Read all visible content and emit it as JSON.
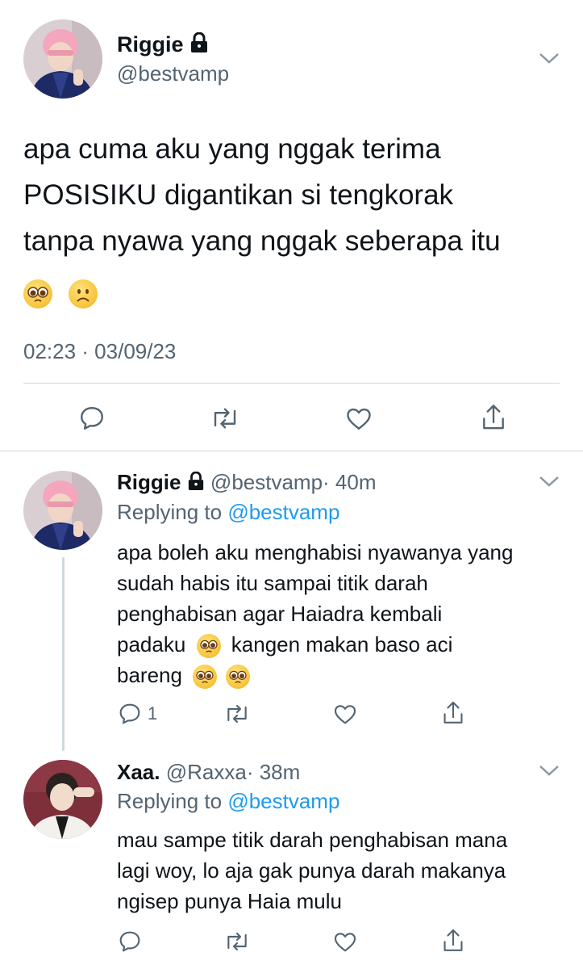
{
  "main_tweet": {
    "name": "Riggie",
    "handle": "@bestvamp",
    "text_line1": "apa cuma aku yang nggak terima",
    "text_line2": "POSISIKU digantikan si tengkorak",
    "text_line3": "tanpa nyawa yang nggak seberapa itu",
    "emojis": [
      "pleading-face",
      "frowning-face"
    ],
    "timestamp": "02:23 · 03/09/23"
  },
  "reply1": {
    "name": "Riggie",
    "handle": "@bestvamp",
    "time": "· 40m",
    "replying_label": "Replying to",
    "replying_handle": "@bestvamp",
    "line1": "apa boleh aku menghabisi nyawanya yang",
    "line2": "sudah habis itu sampai titik darah",
    "line3": "penghabisan agar Haiadra kembali",
    "line4a": "padaku",
    "line4b": "kangen makan baso aci",
    "line5": "bareng",
    "reply_count": "1"
  },
  "reply2": {
    "name": "Xaa.",
    "handle": "@Raxxa",
    "time": "· 38m",
    "replying_label": "Replying to",
    "replying_handle": "@bestvamp",
    "line1": "mau sampe titik darah penghabisan mana",
    "line2": "lagi woy, lo aja gak punya darah makanya",
    "line3": "ngisep punya Haia mulu"
  },
  "colors": {
    "accent": "#1d9bf0",
    "secondary_text": "#536471",
    "divider": "#cfd9de"
  }
}
